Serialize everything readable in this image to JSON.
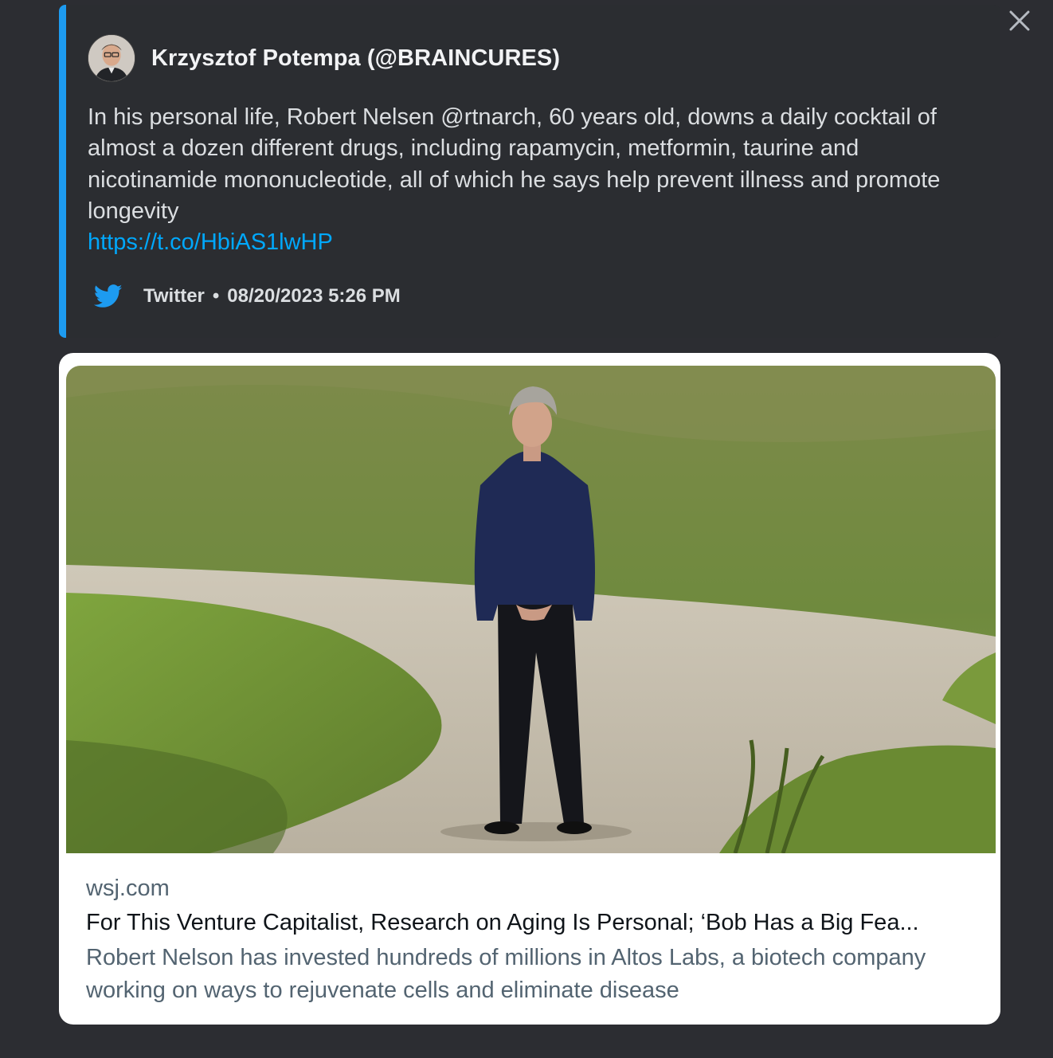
{
  "embed": {
    "accent_color": "#1d9bf0",
    "author": {
      "name": "Krzysztof Potempa (@BRAINCURES)",
      "avatar_icon": "avatar-photo"
    },
    "description": "In his personal life, Robert Nelsen @rtnarch, 60 years old, downs a daily cocktail of almost a dozen different drugs, including rapamycin, metformin, taurine and nicotinamide mononucleotide, all of which he says help prevent illness and promote longevity",
    "link": "https://t.co/HbiAS1lwHP",
    "footer": {
      "icon": "twitter-bird-icon",
      "provider": "Twitter",
      "separator": "•",
      "timestamp": "08/20/2023 5:26 PM"
    }
  },
  "card": {
    "image_icon": "article-photo",
    "domain": "wsj.com",
    "title": "For This Venture Capitalist, Research on Aging Is Personal; ‘Bob Has a Big Fea...",
    "summary": "Robert Nelson has invested hundreds of millions in Altos Labs, a biotech company working on ways to  rejuvenate cells and eliminate disease"
  },
  "close_icon": "close-icon"
}
